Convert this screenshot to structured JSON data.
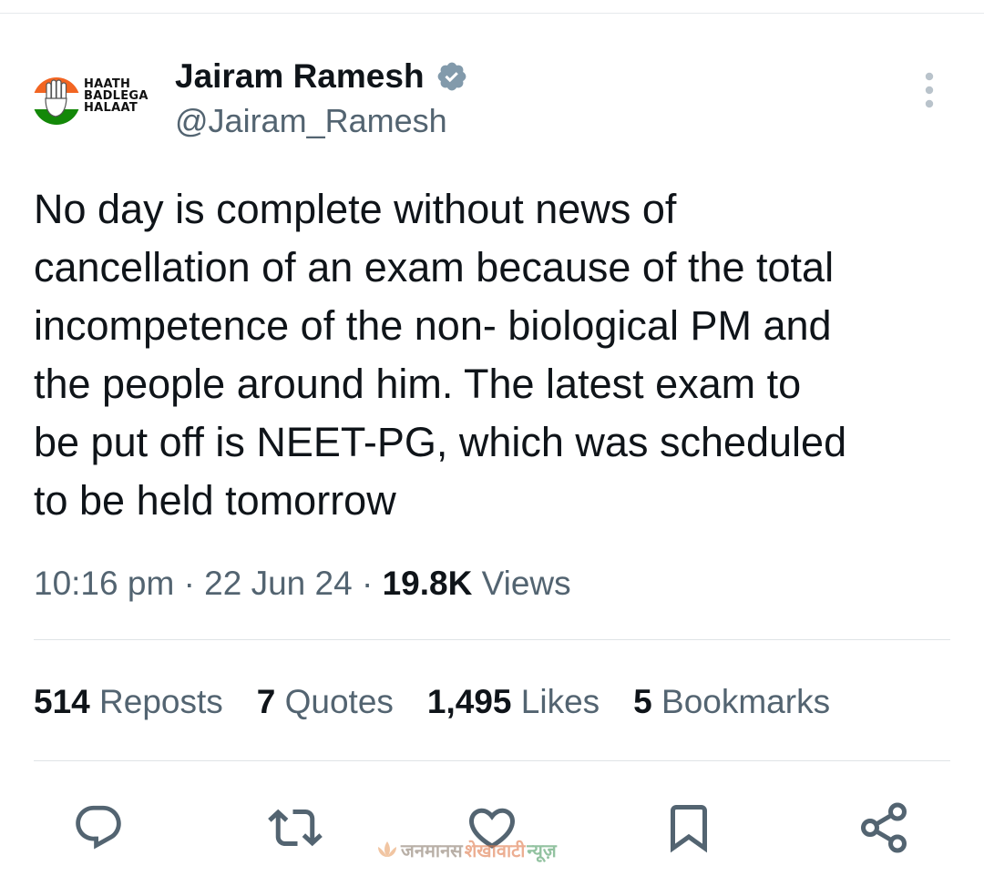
{
  "tweet": {
    "author": {
      "display_name": "Jairam Ramesh",
      "handle": "@Jairam_Ramesh",
      "verified": true,
      "avatar": {
        "icon": "congress-hand-logo",
        "caption_lines": [
          "HAATH",
          "BADLEGA",
          "HALAAT"
        ]
      }
    },
    "text": "No day is complete without news of\ncancellation of an exam because of the total\nincompetence of the non- biological PM and\nthe people around him. The latest exam to\nbe put off is NEET-PG, which was scheduled\nto be held tomorrow",
    "meta": {
      "time": "10:16 pm",
      "separator": "·",
      "date": "22 Jun 24",
      "views_count": "19.8K",
      "views_label": "Views"
    },
    "stats": [
      {
        "count": "514",
        "label": "Reposts"
      },
      {
        "count": "7",
        "label": "Quotes"
      },
      {
        "count": "1,495",
        "label": "Likes"
      },
      {
        "count": "5",
        "label": "Bookmarks"
      }
    ],
    "actions": [
      {
        "name": "reply-icon"
      },
      {
        "name": "repost-icon"
      },
      {
        "name": "like-icon"
      },
      {
        "name": "bookmark-icon"
      },
      {
        "name": "share-icon"
      }
    ]
  },
  "watermark": {
    "icon": "lotus-icon",
    "parts": [
      "जनमानस",
      "शेखावाटी",
      "न्यूज़"
    ]
  },
  "colors": {
    "primary_text": "#0f1419",
    "secondary_text": "#536471",
    "divider": "#dfe3e6",
    "verified_badge": "#829aab",
    "saffron": "#f26522",
    "green": "#138808"
  }
}
